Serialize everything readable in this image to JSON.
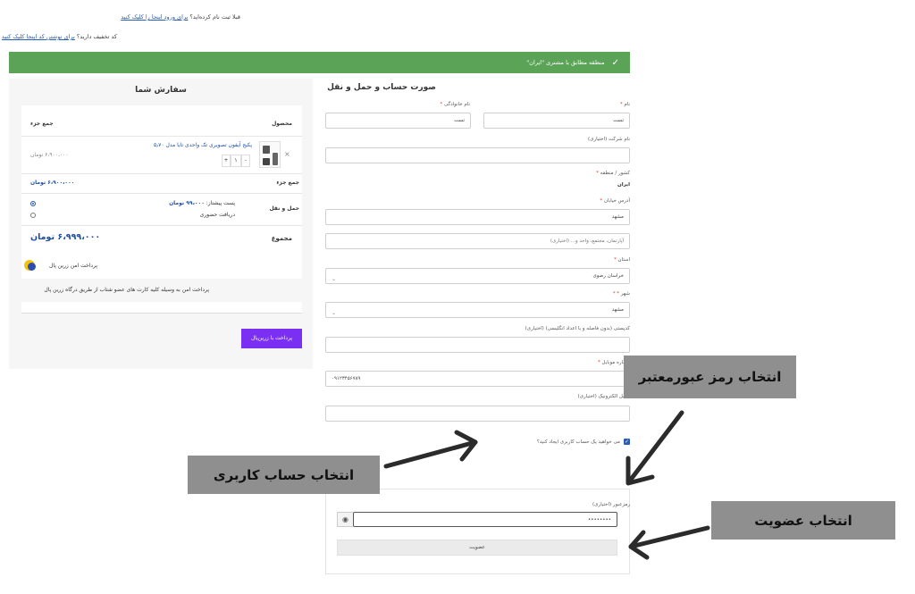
{
  "notices": {
    "login_question": "قبلا ثبت نام کرده‌اید؟",
    "login_link": "برای ورود اینجا را کلیک کنید",
    "coupon_question": "کد تخفیف دارید؟",
    "coupon_link": "برای نوشتن کد اینجا کلیک کنید"
  },
  "success_message": "منطقه مطابق با مشتری \"ایران\"",
  "order": {
    "title": "سفارش شما",
    "col_product": "محصول",
    "col_subtotal": "جمع جزء",
    "product_name": "پکیج آیفون تصویری تک واحدی تابا مدل ۵٫۷۰",
    "quantity": "۱",
    "qty_minus": "-",
    "qty_plus": "+",
    "remove": "×",
    "line_price": "۶،۹۰۰،۰۰۰ تومان",
    "subtotal_label": "جمع جزء",
    "subtotal_value": "۶،۹۰۰،۰۰۰ تومان",
    "shipping_label": "حمل و نقل",
    "shipping_options": [
      {
        "label": "پست پیشتاز:",
        "price": "۹۹،۰۰۰ تومان",
        "selected": true
      },
      {
        "label": "دریافت حضوری",
        "price": "",
        "selected": false
      }
    ],
    "total_label": "مجموع",
    "total_value": "۶،۹۹۹،۰۰۰ تومان",
    "gateway_title": "پرداخت امن زرین پال",
    "gateway_desc": "پرداخت امن به وسیله کلیه کارت های عضو شتاب از طریق درگاه زرین پال",
    "pay_button": "پرداخت با زرین‌پال"
  },
  "billing": {
    "title": "صورت حساب و حمل و نقل",
    "first_name_label": "نام",
    "first_name_value": "تست",
    "last_name_label": "نام خانوادگی",
    "last_name_value": "تست",
    "company_label": "نام شرکت (اختیاری)",
    "country_label": "کشور / منطقه",
    "country_value": "ایران",
    "address_label": "آدرس خیابان",
    "address_value": "مشهد",
    "address2_placeholder": "آپارتمان، مجتمع، واحد و... (اختیاری)",
    "state_label": "استان",
    "state_value": "خراسان رضوی",
    "city_label": "شهر",
    "city_value": "مشهد",
    "postcode_label": "کدپستی (بدون فاصله و با اعداد انگلیسی) (اختیاری)",
    "phone_label": "شماره موبایل",
    "phone_value": "۰۹۱۲۳۴۵۶۷۸۹",
    "email_label": "ایمیل الکترونیک (اختیاری)",
    "create_account_label": "می خواهید یک حساب کاربری ایجاد کنید؟",
    "create_account_checked": true,
    "password_label": "رمزعبور (اختیاری)",
    "password_value": "••••••••",
    "register_button": "عضویت"
  },
  "annotations": {
    "password_note": "انتخاب رمز عبورمعتبر",
    "account_note": "انتخاب حساب کاربری",
    "register_note": "انتخاب عضویت"
  },
  "colors": {
    "success_green": "#5aa357",
    "pay_purple": "#7b2ff2",
    "link_blue": "#2a5db0",
    "annotation_grey": "#8f8f8f"
  }
}
